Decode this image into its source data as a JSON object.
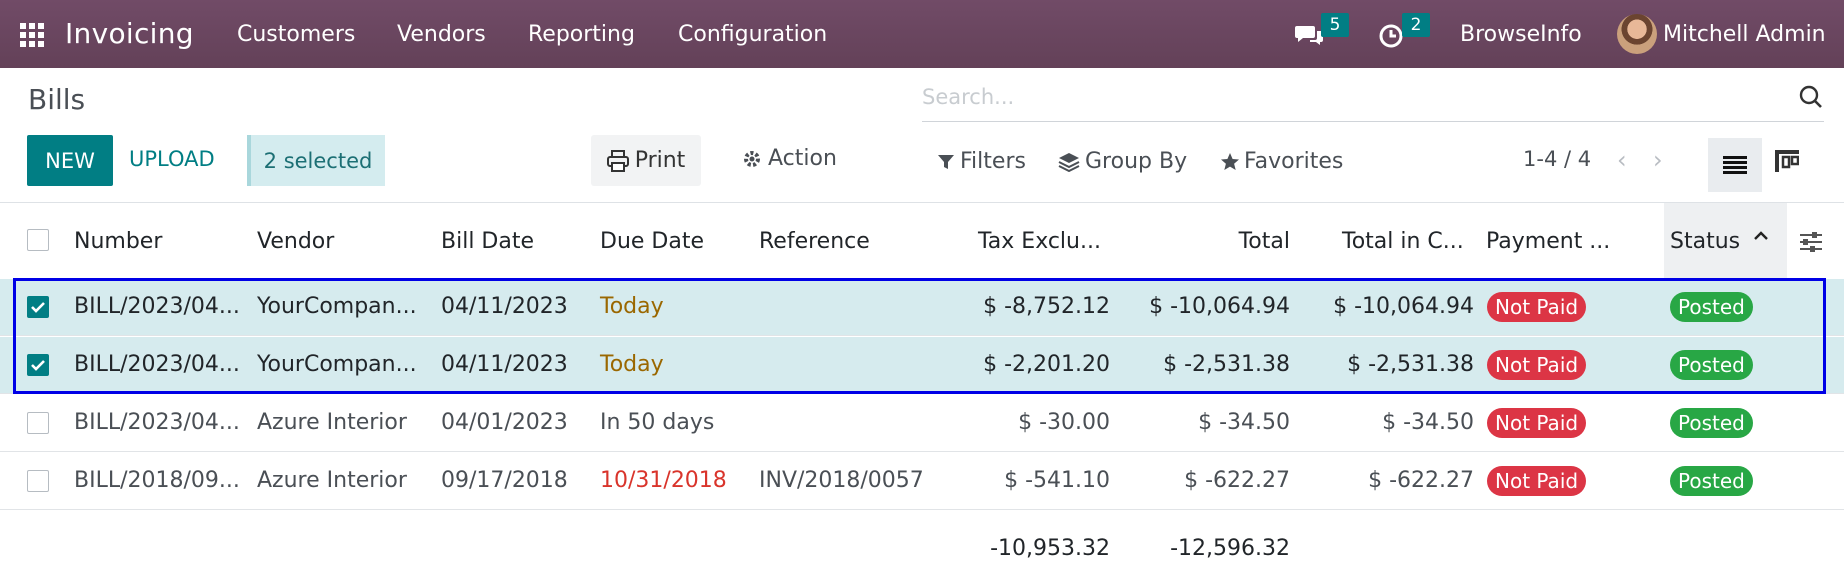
{
  "topbar": {
    "app_name": "Invoicing",
    "menu": [
      "Customers",
      "Vendors",
      "Reporting",
      "Configuration"
    ],
    "messages_count": "5",
    "activities_count": "2",
    "company": "BrowseInfo",
    "user": "Mitchell Admin"
  },
  "page": {
    "title": "Bills",
    "search_placeholder": "Search...",
    "new_label": "NEW",
    "upload_label": "UPLOAD",
    "selected_label": "2 selected",
    "print_label": "Print",
    "action_label": "Action",
    "filters_label": "Filters",
    "groupby_label": "Group By",
    "favorites_label": "Favorites",
    "pager": "1-4 / 4"
  },
  "table": {
    "headers": [
      "Number",
      "Vendor",
      "Bill Date",
      "Due Date",
      "Reference",
      "Tax Exclu...",
      "Total",
      "Total in C...",
      "Payment ...",
      "Status"
    ],
    "rows": [
      {
        "number": "BILL/2023/04...",
        "vendor": "YourCompan...",
        "bill_date": "04/11/2023",
        "due_date": "Today",
        "due_color": "#9a6700",
        "reference": "",
        "tax_excl": "$ -8,752.12",
        "total": "$ -10,064.94",
        "total_cur": "$ -10,064.94",
        "payment": "Not Paid",
        "status": "Posted",
        "selected": true
      },
      {
        "number": "BILL/2023/04...",
        "vendor": "YourCompan...",
        "bill_date": "04/11/2023",
        "due_date": "Today",
        "due_color": "#9a6700",
        "reference": "",
        "tax_excl": "$ -2,201.20",
        "total": "$ -2,531.38",
        "total_cur": "$ -2,531.38",
        "payment": "Not Paid",
        "status": "Posted",
        "selected": true
      },
      {
        "number": "BILL/2023/04...",
        "vendor": "Azure Interior",
        "bill_date": "04/01/2023",
        "due_date": "In 50 days",
        "due_color": "#4a4f55",
        "reference": "",
        "tax_excl": "$ -30.00",
        "total": "$ -34.50",
        "total_cur": "$ -34.50",
        "payment": "Not Paid",
        "status": "Posted",
        "selected": false
      },
      {
        "number": "BILL/2018/09...",
        "vendor": "Azure Interior",
        "bill_date": "09/17/2018",
        "due_date": "10/31/2018",
        "due_color": "#d9342b",
        "reference": "INV/2018/0057",
        "tax_excl": "$ -541.10",
        "total": "$ -622.27",
        "total_cur": "$ -622.27",
        "payment": "Not Paid",
        "status": "Posted",
        "selected": false
      }
    ],
    "totals": {
      "tax_excl": "-10,953.32",
      "total": "-12,596.32"
    }
  },
  "colors": {
    "topbar": "#714b67",
    "accent": "#017e84",
    "danger": "#dc3545",
    "success": "#28a745",
    "highlight": "#0000e6"
  }
}
